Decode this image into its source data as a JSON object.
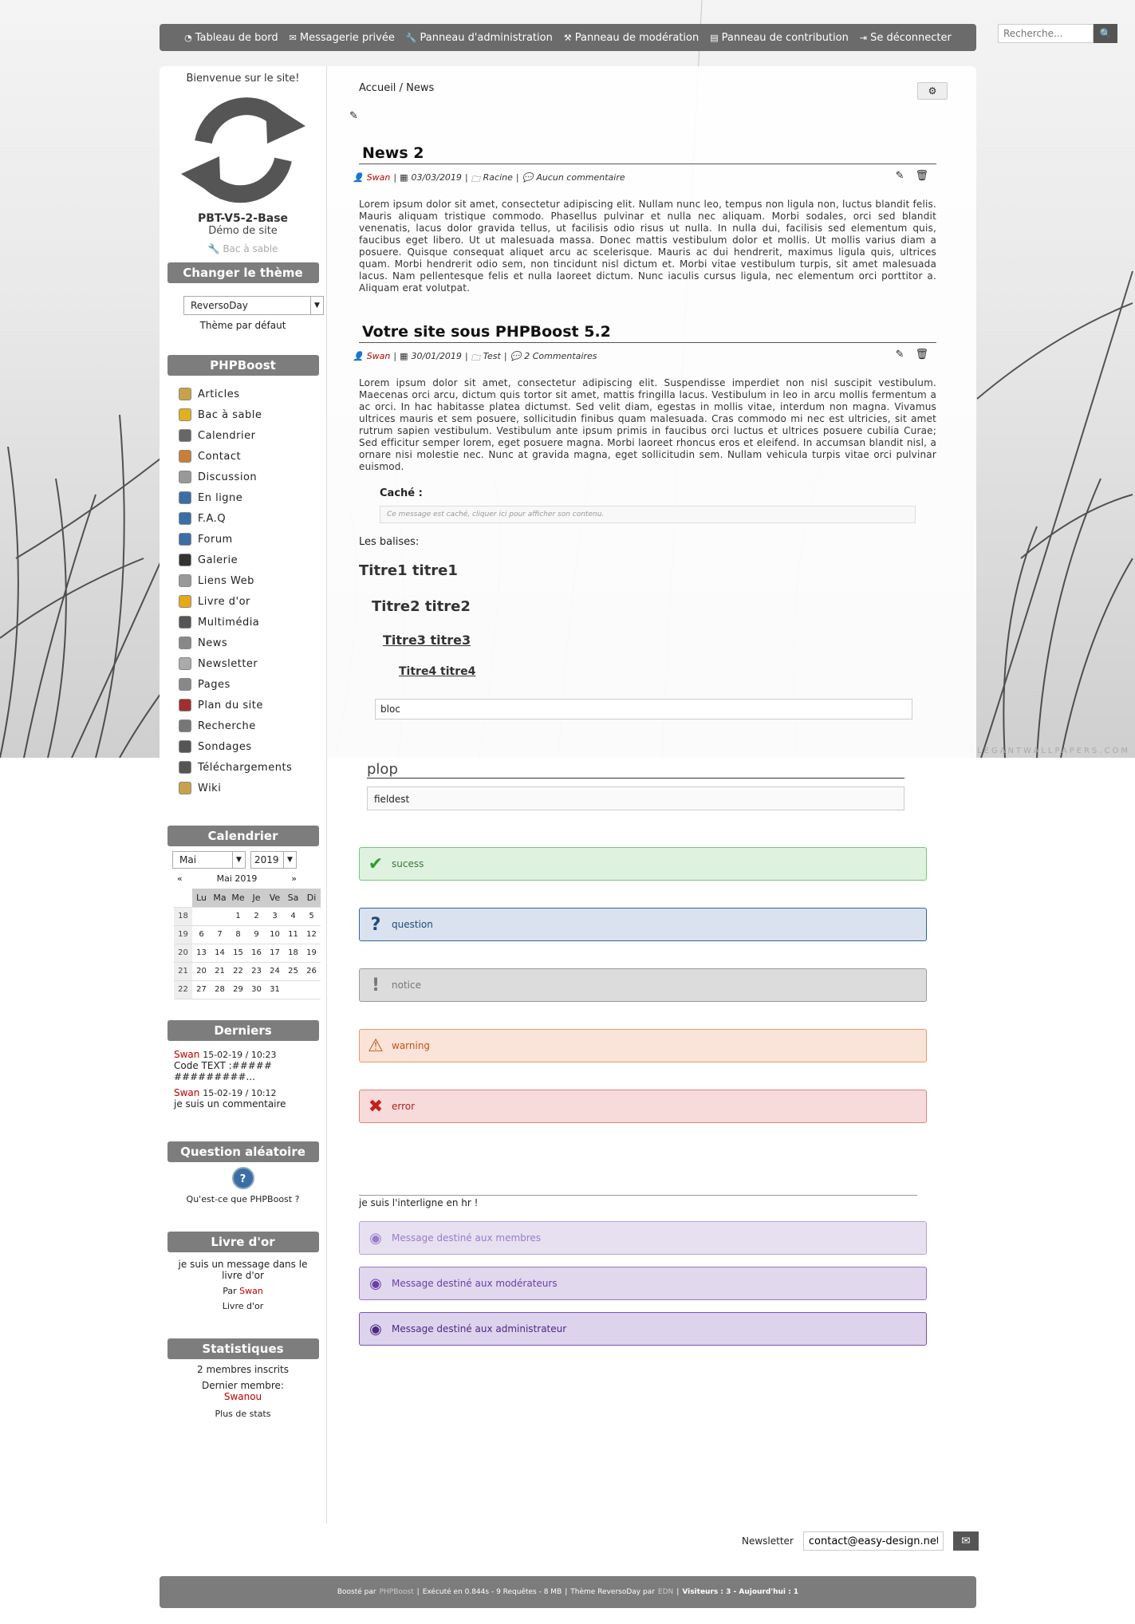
{
  "topnav": [
    "Tableau de bord",
    "Messagerie privée",
    "Panneau d'administration",
    "Panneau de modération",
    "Panneau de contribution",
    "Se déconnecter"
  ],
  "search": {
    "placeholder": "Recherche..."
  },
  "watermark": "ELEGANTWALLPAPERS.COM",
  "side": {
    "welcome": "Bienvenue sur le site!",
    "site_name": "PBT-V5-2-Base",
    "slogan": "Démo de site",
    "sandbox": "Bac à sable",
    "theme_title": "Changer le thème",
    "theme_value": "ReversoDay",
    "theme_default": "Thème par défaut",
    "menu_title": "PHPBoost",
    "menu": [
      "Articles",
      "Bac à sable",
      "Calendrier",
      "Contact",
      "Discussion",
      "En ligne",
      "F.A.Q",
      "Forum",
      "Galerie",
      "Liens Web",
      "Livre d'or",
      "Multimédia",
      "News",
      "Newsletter",
      "Pages",
      "Plan du site",
      "Recherche",
      "Sondages",
      "Téléchargements",
      "Wiki"
    ],
    "cal_title": "Calendrier",
    "cal_month": "Mai",
    "cal_year": "2019",
    "cal_label": "Mai 2019",
    "cal_days": [
      "Lu",
      "Ma",
      "Me",
      "Je",
      "Ve",
      "Sa",
      "Di"
    ],
    "cal_weeks": [
      {
        "wk": "18",
        "d": [
          "",
          "",
          "1",
          "2",
          "3",
          "4",
          "5"
        ]
      },
      {
        "wk": "19",
        "d": [
          "6",
          "7",
          "8",
          "9",
          "10",
          "11",
          "12"
        ]
      },
      {
        "wk": "20",
        "d": [
          "13",
          "14",
          "15",
          "16",
          "17",
          "18",
          "19"
        ]
      },
      {
        "wk": "21",
        "d": [
          "20",
          "21",
          "22",
          "23",
          "24",
          "25",
          "26"
        ]
      },
      {
        "wk": "22",
        "d": [
          "27",
          "28",
          "29",
          "30",
          "31",
          "",
          ""
        ]
      }
    ],
    "comments_title": "Derniers commentaires",
    "comments": [
      {
        "user": "Swan",
        "date": "15-02-19 / 10:23",
        "text": "Code TEXT :##############..."
      },
      {
        "user": "Swan",
        "date": "15-02-19 / 10:12",
        "text": "je suis un commentaire"
      }
    ],
    "question_title": "Question aléatoire",
    "question": "Qu'est-ce que PHPBoost ?",
    "guestbook_title": "Livre d'or",
    "guestbook_msg": "je suis un message dans le livre d'or",
    "guestbook_by": "Par",
    "guestbook_user": "Swan",
    "guestbook_link": "Livre d'or",
    "stats_title": "Statistiques",
    "stats_members": "2 membres inscrits",
    "stats_last_label": "Dernier membre:",
    "stats_last_user": "Swanou",
    "stats_more": "Plus de stats"
  },
  "breadcrumb": {
    "home": "Accueil",
    "sep": "/",
    "current": "News"
  },
  "articles": [
    {
      "title": "News 2",
      "author": "Swan",
      "date": "03/03/2019",
      "category": "Racine",
      "comments": "Aucun commentaire",
      "body": "Lorem ipsum dolor sit amet, consectetur adipiscing elit. Nullam nunc leo, tempus non ligula non, luctus blandit felis. Mauris aliquam tristique commodo. Phasellus pulvinar et nulla nec aliquam. Morbi sodales, orci sed blandit venenatis, lacus dolor gravida tellus, ut facilisis odio risus ut nulla. In nulla dui, facilisis sed elementum quis, faucibus eget libero. Ut ut malesuada massa. Donec mattis vestibulum dolor et mollis. Ut mollis varius diam a posuere. Quisque consequat aliquet arcu ac scelerisque. Mauris ac dui hendrerit, maximus ligula quis, ultrices quam. Morbi hendrerit odio sem, non tincidunt nisl dictum et. Morbi vitae vestibulum turpis, sit amet malesuada lacus. Nam pellentesque felis et nulla laoreet dictum. Nunc iaculis cursus ligula, nec elementum orci porttitor a. Aliquam erat volutpat."
    },
    {
      "title": "Votre site sous PHPBoost 5.2",
      "author": "Swan",
      "date": "30/01/2019",
      "category": "Test",
      "comments": "2 Commentaires",
      "body": "Lorem ipsum dolor sit amet, consectetur adipiscing elit. Suspendisse imperdiet non nisl suscipit vestibulum. Maecenas orci arcu, dictum quis tortor sit amet, mattis fringilla lacus. Vestibulum in leo in arcu mollis fermentum a ac orci. In hac habitasse platea dictumst. Sed velit diam, egestas in mollis vitae, interdum non magna. Vivamus ultrices mauris et sem posuere, sollicitudin finibus quam malesuada. Cras commodo mi nec est ultricies, sit amet rutrum sapien vestibulum. Vestibulum ante ipsum primis in faucibus orci luctus et ultrices posuere cubilia Curae; Sed efficitur semper lorem, eget posuere magna. Morbi laoreet rhoncus eros et eleifend. In accumsan blandit nisl, a ornare nisi molestie nec. Nunc at gravida magna, eget sollicitudin sem. Nullam vehicula turpis vitae orci pulvinar euismod."
    }
  ],
  "hidden_label": "Caché :",
  "hidden_text": "Ce message est caché, cliquer ici pour afficher son contenu.",
  "balises": "Les balises:",
  "t1": "Titre1 titre1",
  "t2": "Titre2 titre2",
  "t3": "Titre3 titre3",
  "t4": "Titre4 titre4",
  "bloc": "bloc",
  "fieldset_legend": "plop",
  "fieldset_text": "fieldest",
  "messages": [
    {
      "text": "sucess",
      "bg": "#dff2df",
      "border": "#7cc47c",
      "color": "#3c763d",
      "icon": "✔",
      "icolor": "#2e9a2e"
    },
    {
      "text": "question",
      "bg": "#d9e2ee",
      "border": "#336699",
      "color": "#234a77",
      "icon": "?",
      "icolor": "#234a77"
    },
    {
      "text": "notice",
      "bg": "#dcdcdc",
      "border": "#999999",
      "color": "#777777",
      "icon": "!",
      "icolor": "#777777"
    },
    {
      "text": "warning",
      "bg": "#fae3d8",
      "border": "#e39b72",
      "color": "#c55418",
      "icon": "⚠",
      "icolor": "#c55418"
    },
    {
      "text": "error",
      "bg": "#f7dada",
      "border": "#e38080",
      "color": "#b32222",
      "icon": "✖",
      "icolor": "#c61f1f"
    }
  ],
  "hr_text": "je suis l'interligne en hr !",
  "member_msgs": [
    {
      "text": "Message destiné aux membres",
      "color": "#9a7cc9",
      "bg": "#e7e0f0",
      "border": "#b8a3d8"
    },
    {
      "text": "Message destiné aux modérateurs",
      "color": "#6b3fa5",
      "bg": "#e1d8ee",
      "border": "#9a78c6"
    },
    {
      "text": "Message destiné aux administrateur",
      "color": "#4d2887",
      "bg": "#ddd3ec",
      "border": "#7a54b1"
    }
  ],
  "newsletter": {
    "label": "Newsletter",
    "value": "contact@easy-design.net"
  },
  "footer": {
    "boosted": "Boosté par",
    "phpboost": "PHPBoost",
    "exec": "Exécuté en 0.844s - 9 Requêtes - 8 MB",
    "theme": "Thème ReversoDay par",
    "edn": "EDN",
    "visitors": "Visiteurs : 3 - Aujourd'hui : 1"
  }
}
